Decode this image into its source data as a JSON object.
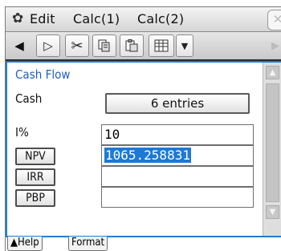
{
  "menu": {
    "gear_icon": "✿",
    "edit": "Edit",
    "calc1": "Calc(1)",
    "calc2": "Calc(2)",
    "close_icon": "✕"
  },
  "toolbar": {
    "back_icon": "◀",
    "forward_icon": "▷",
    "cut_icon": "✂",
    "copy_icon": "copy",
    "paste_icon": "paste",
    "grid_icon": "grid",
    "dropdown_icon": "▼",
    "next_icon": "▶"
  },
  "cashflow": {
    "title": "Cash Flow",
    "cash_label": "Cash",
    "entries_button": "6 entries",
    "interest_label": "I%",
    "interest_value": "10",
    "npv_button": "NPV",
    "npv_value": "1065.258831",
    "irr_button": "IRR",
    "irr_value": "",
    "pbp_button": "PBP",
    "pbp_value": ""
  },
  "scroll": {
    "up_icon": "▲",
    "down_icon": "▼"
  },
  "tabs": {
    "help": "▲Help",
    "format": "Format"
  }
}
